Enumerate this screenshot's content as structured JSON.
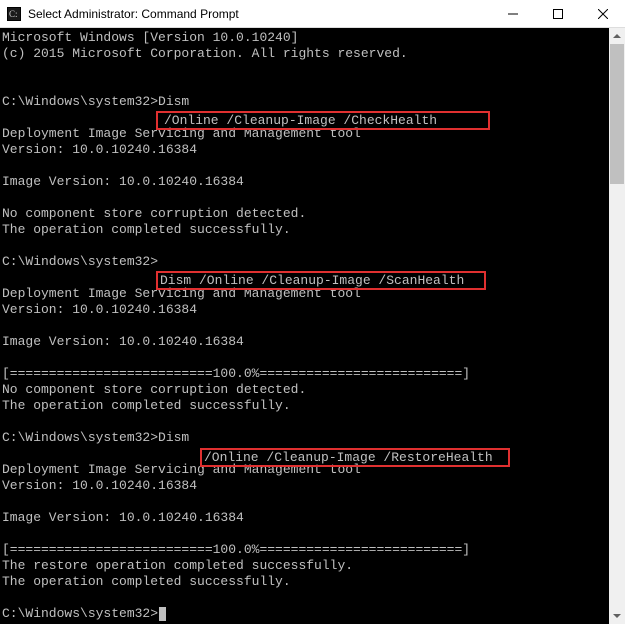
{
  "titlebar": {
    "title": "Select Administrator: Command Prompt"
  },
  "console": {
    "header_line1": "Microsoft Windows [Version 10.0.10240]",
    "header_line2": "(c) 2015 Microsoft Corporation. All rights reserved.",
    "prompt1_path": "C:\\Windows\\system32>",
    "prompt1_cmd_prefix": "Dism ",
    "prompt1_highlight": "/Online /Cleanup-Image /CheckHealth",
    "tool_line1": "Deployment Image Servicing and Management tool",
    "tool_version": "Version: 10.0.10240.16384",
    "image_version": "Image Version: 10.0.10240.16384",
    "result1_line1": "No component store corruption detected.",
    "success_line": "The operation completed successfully.",
    "prompt2_path": "C:\\Windows\\system32>",
    "prompt2_highlight": "Dism /Online /Cleanup-Image /ScanHealth",
    "progress_line": "[==========================100.0%==========================]",
    "prompt3_path": "C:\\Windows\\system32>",
    "prompt3_cmd_prefix": "Dism ",
    "prompt3_highlight": "/Online /Cleanup-Image /RestoreHealth",
    "restore_success": "The restore operation completed successfully.",
    "final_prompt": "C:\\Windows\\system32>"
  }
}
